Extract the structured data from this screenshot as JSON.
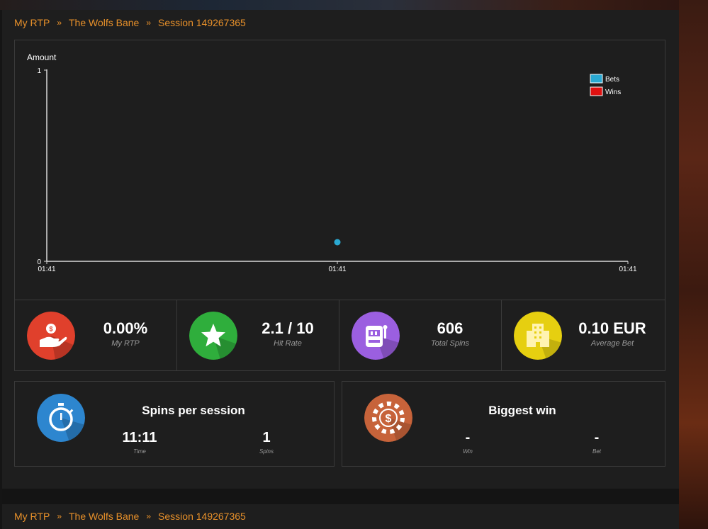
{
  "breadcrumb": {
    "home": "My RTP",
    "game": "The Wolfs Bane",
    "session": "Session 149267365",
    "separator": "»"
  },
  "chart_data": {
    "type": "scatter",
    "ylabel": "Amount",
    "ylim": [
      0,
      1
    ],
    "y_ticks": [
      "0",
      "1"
    ],
    "x_ticks": [
      "01:41",
      "01:41",
      "01:41"
    ],
    "legend_position": "top-right",
    "series": [
      {
        "name": "Bets",
        "color": "#2aa9d2",
        "points": [
          {
            "x": "01:41",
            "y": 0.1
          }
        ]
      },
      {
        "name": "Wins",
        "color": "#e01010",
        "points": []
      }
    ]
  },
  "stats": [
    {
      "value": "0.00%",
      "label": "My RTP",
      "icon": "hand-money-icon",
      "color": "#e0402c"
    },
    {
      "value": "2.1 / 10",
      "label": "Hit Rate",
      "icon": "star-icon",
      "color": "#2fae3c"
    },
    {
      "value": "606",
      "label": "Total Spins",
      "icon": "slot-machine-icon",
      "color": "#9b5fe0"
    },
    {
      "value": "0.10 EUR",
      "label": "Average Bet",
      "icon": "building-icon",
      "color": "#e6cf10"
    }
  ],
  "session": {
    "title": "Spins per session",
    "time_value": "11:11",
    "time_label": "Time",
    "spins_value": "1",
    "spins_label": "Spins",
    "icon": "stopwatch-icon",
    "color": "#2d86cf"
  },
  "biggest_win": {
    "title": "Biggest win",
    "win_value": "-",
    "win_label": "Win",
    "bet_value": "-",
    "bet_label": "Bet",
    "icon": "casino-chip-icon",
    "color": "#c7633a"
  },
  "footer_breadcrumb": {
    "home": "My RTP",
    "game": "The Wolfs Bane",
    "session": "Session 149267365",
    "separator": "»"
  }
}
